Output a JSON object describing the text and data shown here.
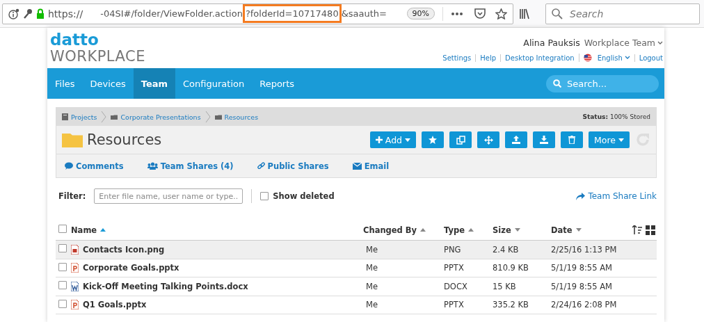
{
  "browser": {
    "url_scheme": "https://",
    "url_path": "-04SI#/folder/ViewFolder.action",
    "url_query": {
      "text": "?folderId=10717480",
      "highlighted": true
    },
    "url_tail": "&saauth=",
    "zoom": "90%",
    "search_placeholder": "Search"
  },
  "header": {
    "logo_top": "datto",
    "logo_bottom": "WORKPLACE",
    "user": "Alina Pauksis",
    "team": "Workplace Team",
    "links": [
      {
        "label": "Settings",
        "kind": "text"
      },
      {
        "label": "Help",
        "kind": "text"
      },
      {
        "label": "Desktop Integration",
        "kind": "text"
      },
      {
        "label": "English",
        "kind": "language"
      },
      {
        "label": "Logout",
        "kind": "text"
      }
    ]
  },
  "nav": {
    "tabs": [
      {
        "label": "Files",
        "selected": false
      },
      {
        "label": "Devices",
        "selected": false
      },
      {
        "label": "Team",
        "selected": true
      },
      {
        "label": "Configuration",
        "selected": false
      },
      {
        "label": "Reports",
        "selected": false
      }
    ],
    "search_placeholder": "Search..."
  },
  "breadcrumbs": [
    {
      "label": "Projects",
      "kind": "project"
    },
    {
      "label": "Corporate Presentations",
      "kind": "folder"
    },
    {
      "label": "Resources",
      "kind": "folder"
    }
  ],
  "status": {
    "label": "Status:",
    "value": "100% Stored"
  },
  "folder_title": "Resources",
  "toolbar": [
    {
      "kind": "add",
      "label": "Add"
    },
    {
      "kind": "star"
    },
    {
      "kind": "copy"
    },
    {
      "kind": "move"
    },
    {
      "kind": "upload"
    },
    {
      "kind": "download"
    },
    {
      "kind": "delete"
    },
    {
      "kind": "more",
      "label": "More"
    }
  ],
  "share_links": [
    {
      "kind": "comment",
      "label": "Comments"
    },
    {
      "kind": "team",
      "label": "Team Shares (4)"
    },
    {
      "kind": "link",
      "label": "Public Shares"
    },
    {
      "kind": "email",
      "label": "Email"
    }
  ],
  "filter": {
    "label": "Filter:",
    "placeholder": "Enter file name, user name or type...",
    "show_deleted": {
      "label": "Show deleted",
      "checked": false
    },
    "team_share_link": "Team Share Link"
  },
  "table": {
    "select_all": {
      "checked": false
    },
    "columns": [
      {
        "label": "Name",
        "ascending": true,
        "active": true
      },
      {
        "label": "Changed By",
        "ascending": true,
        "active": false
      },
      {
        "label": "Type",
        "ascending": true,
        "active": false
      },
      {
        "label": "Size",
        "ascending": false,
        "active": false
      },
      {
        "label": "Date",
        "ascending": false,
        "active": false
      }
    ],
    "rows": [
      {
        "kind": "image",
        "name": "Contacts Icon.png",
        "changed_by": "Me",
        "type": "PNG",
        "size": "2.4 KB",
        "date": "2/25/16 1:13 PM",
        "checked": false,
        "highlighted": true
      },
      {
        "kind": "powerpoint",
        "name": "Corporate Goals.pptx",
        "changed_by": "Me",
        "type": "PPTX",
        "size": "810.9 KB",
        "date": "5/1/19 8:55 AM",
        "checked": false,
        "highlighted": false
      },
      {
        "kind": "word",
        "name": "Kick-Off Meeting Talking Points.docx",
        "changed_by": "Me",
        "type": "DOCX",
        "size": "15 KB",
        "date": "5/1/19 8:55 AM",
        "checked": false,
        "highlighted": false
      },
      {
        "kind": "powerpoint",
        "name": "Q1 Goals.pptx",
        "changed_by": "Me",
        "type": "PPTX",
        "size": "335.2 KB",
        "date": "2/24/16 2:08 PM",
        "checked": false,
        "highlighted": false
      }
    ]
  }
}
